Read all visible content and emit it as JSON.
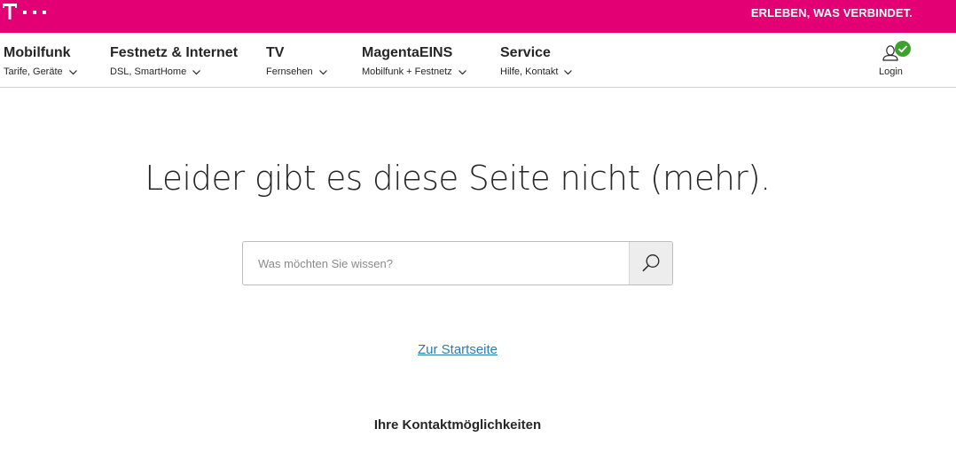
{
  "brand": {
    "color": "#e20074",
    "logo_icon": "telekom-t-logo-icon",
    "tagline": "ERLEBEN, WAS VERBINDET."
  },
  "nav": {
    "items": [
      {
        "title": "Mobilfunk",
        "sub": "Tarife, Geräte"
      },
      {
        "title": "Festnetz & Internet",
        "sub": "DSL, SmartHome"
      },
      {
        "title": "TV",
        "sub": "Fernsehen"
      },
      {
        "title": "MagentaEINS",
        "sub": "Mobilfunk + Festnetz"
      },
      {
        "title": "Service",
        "sub": "Hilfe, Kontakt"
      }
    ],
    "login_label": "Login",
    "login_icon": "user-icon",
    "login_status_icon": "check-badge-icon",
    "login_status_color": "#3ea02d"
  },
  "main": {
    "headline": "Leider gibt es diese Seite nicht (mehr).",
    "search": {
      "placeholder": "Was möchten Sie wissen?",
      "value": "",
      "button_icon": "search-icon"
    },
    "home_link": "Zur Startseite",
    "link_color": "#2a7cad",
    "contact_title": "Ihre Kontaktmöglichkeiten"
  }
}
